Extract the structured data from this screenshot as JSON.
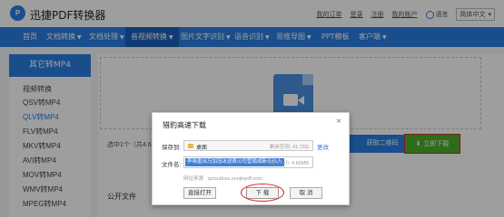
{
  "app": {
    "logo_glyph": "P",
    "title": "迅捷PDF转换器"
  },
  "toplinks": {
    "items": [
      "我的订单",
      "登录",
      "注册",
      "我的账户"
    ],
    "language_label": "语言",
    "language_value": "简体中文"
  },
  "nav": {
    "items": [
      {
        "label": "首页",
        "caret": false
      },
      {
        "label": "文档转换",
        "caret": true
      },
      {
        "label": "文档处理",
        "caret": true
      },
      {
        "label": "音视频转换",
        "caret": true
      },
      {
        "label": "图片文字识别",
        "caret": true
      },
      {
        "label": "语音识别",
        "caret": true
      },
      {
        "label": "思维导图",
        "caret": true
      },
      {
        "label": "PPT模板",
        "caret": false
      },
      {
        "label": "客户端",
        "caret": true
      }
    ],
    "active_index": 3
  },
  "sidebar": {
    "header": "其它转MP4",
    "items": [
      "视频转换",
      "QSV转MP4",
      "QLV转MP4",
      "FLV转MP4",
      "MKV转MP4",
      "AVI转MP4",
      "MOV转MP4",
      "WMV转MP4",
      "MPEG转MP4"
    ],
    "active_index": 2
  },
  "main": {
    "status": "选中1个（共4.65",
    "qr_button": "获取二维码",
    "download_button": "立即下载",
    "public_label": "公开文件"
  },
  "dialog": {
    "title": "猎豹高速下载",
    "close": "×",
    "save_label": "保存到:",
    "save_path": "桌面",
    "space_text": "剩余空间: 41.73G",
    "change_label": "更改",
    "filename_label": "文件名:",
    "filename_value": "李晓墨出马加冠冰途首公司营局成新合伙人",
    "filesize_text": "文件大小: 4.65MB",
    "link_label": "网址来源",
    "link_value": "qcloudoss.xunjiepdf.com",
    "open_button": "直接打开",
    "download_button": "下 载",
    "cancel_button": "取 消"
  },
  "colors": {
    "brand": "#2a7de1",
    "download_green": "#4cae2a",
    "highlight_red": "#d22222"
  },
  "icons": [
    "logo-icon",
    "globe-icon",
    "video-file-icon",
    "down-arrow-icon",
    "folder-icon",
    "close-icon"
  ]
}
